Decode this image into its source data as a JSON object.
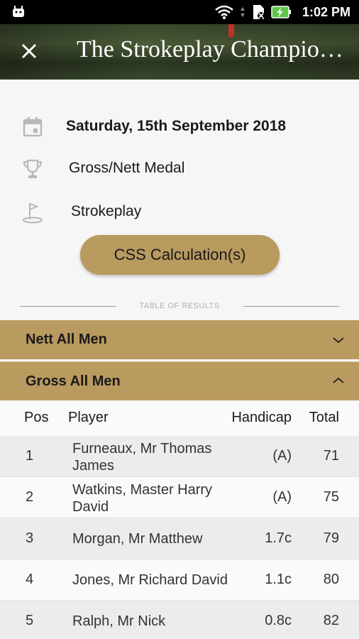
{
  "status_bar": {
    "time": "1:02 PM"
  },
  "header": {
    "title": "The Strokeplay Championship"
  },
  "info": {
    "date": "Saturday, 15th September 2018",
    "format": "Gross/Nett Medal",
    "type": "Strokeplay"
  },
  "css_button": "CSS Calculation(s)",
  "divider_label": "TABLE OF RESULTS",
  "sections": [
    {
      "label": "Nett All Men",
      "expanded": false
    },
    {
      "label": "Gross All Men",
      "expanded": true
    }
  ],
  "table": {
    "columns": [
      "Pos",
      "Player",
      "Handicap",
      "Total"
    ],
    "rows": [
      {
        "pos": "1",
        "player_l1": "Furneaux, Mr Thomas",
        "player_l2": "James",
        "handicap": "(A)",
        "total": "71"
      },
      {
        "pos": "2",
        "player_l1": "Watkins, Master Harry",
        "player_l2": "David",
        "handicap": "(A)",
        "total": "75"
      },
      {
        "pos": "3",
        "player_l1": "Morgan, Mr Matthew",
        "player_l2": "",
        "handicap": "1.7c",
        "total": "79"
      },
      {
        "pos": "4",
        "player_l1": "Jones, Mr Richard David",
        "player_l2": "",
        "handicap": "1.1c",
        "total": "80"
      },
      {
        "pos": "5",
        "player_l1": "Ralph, Mr Nick",
        "player_l2": "",
        "handicap": "0.8c",
        "total": "82"
      }
    ]
  },
  "colors": {
    "accent": "#b99a5f",
    "row_alt": "#ececec",
    "row": "#fafafa"
  }
}
